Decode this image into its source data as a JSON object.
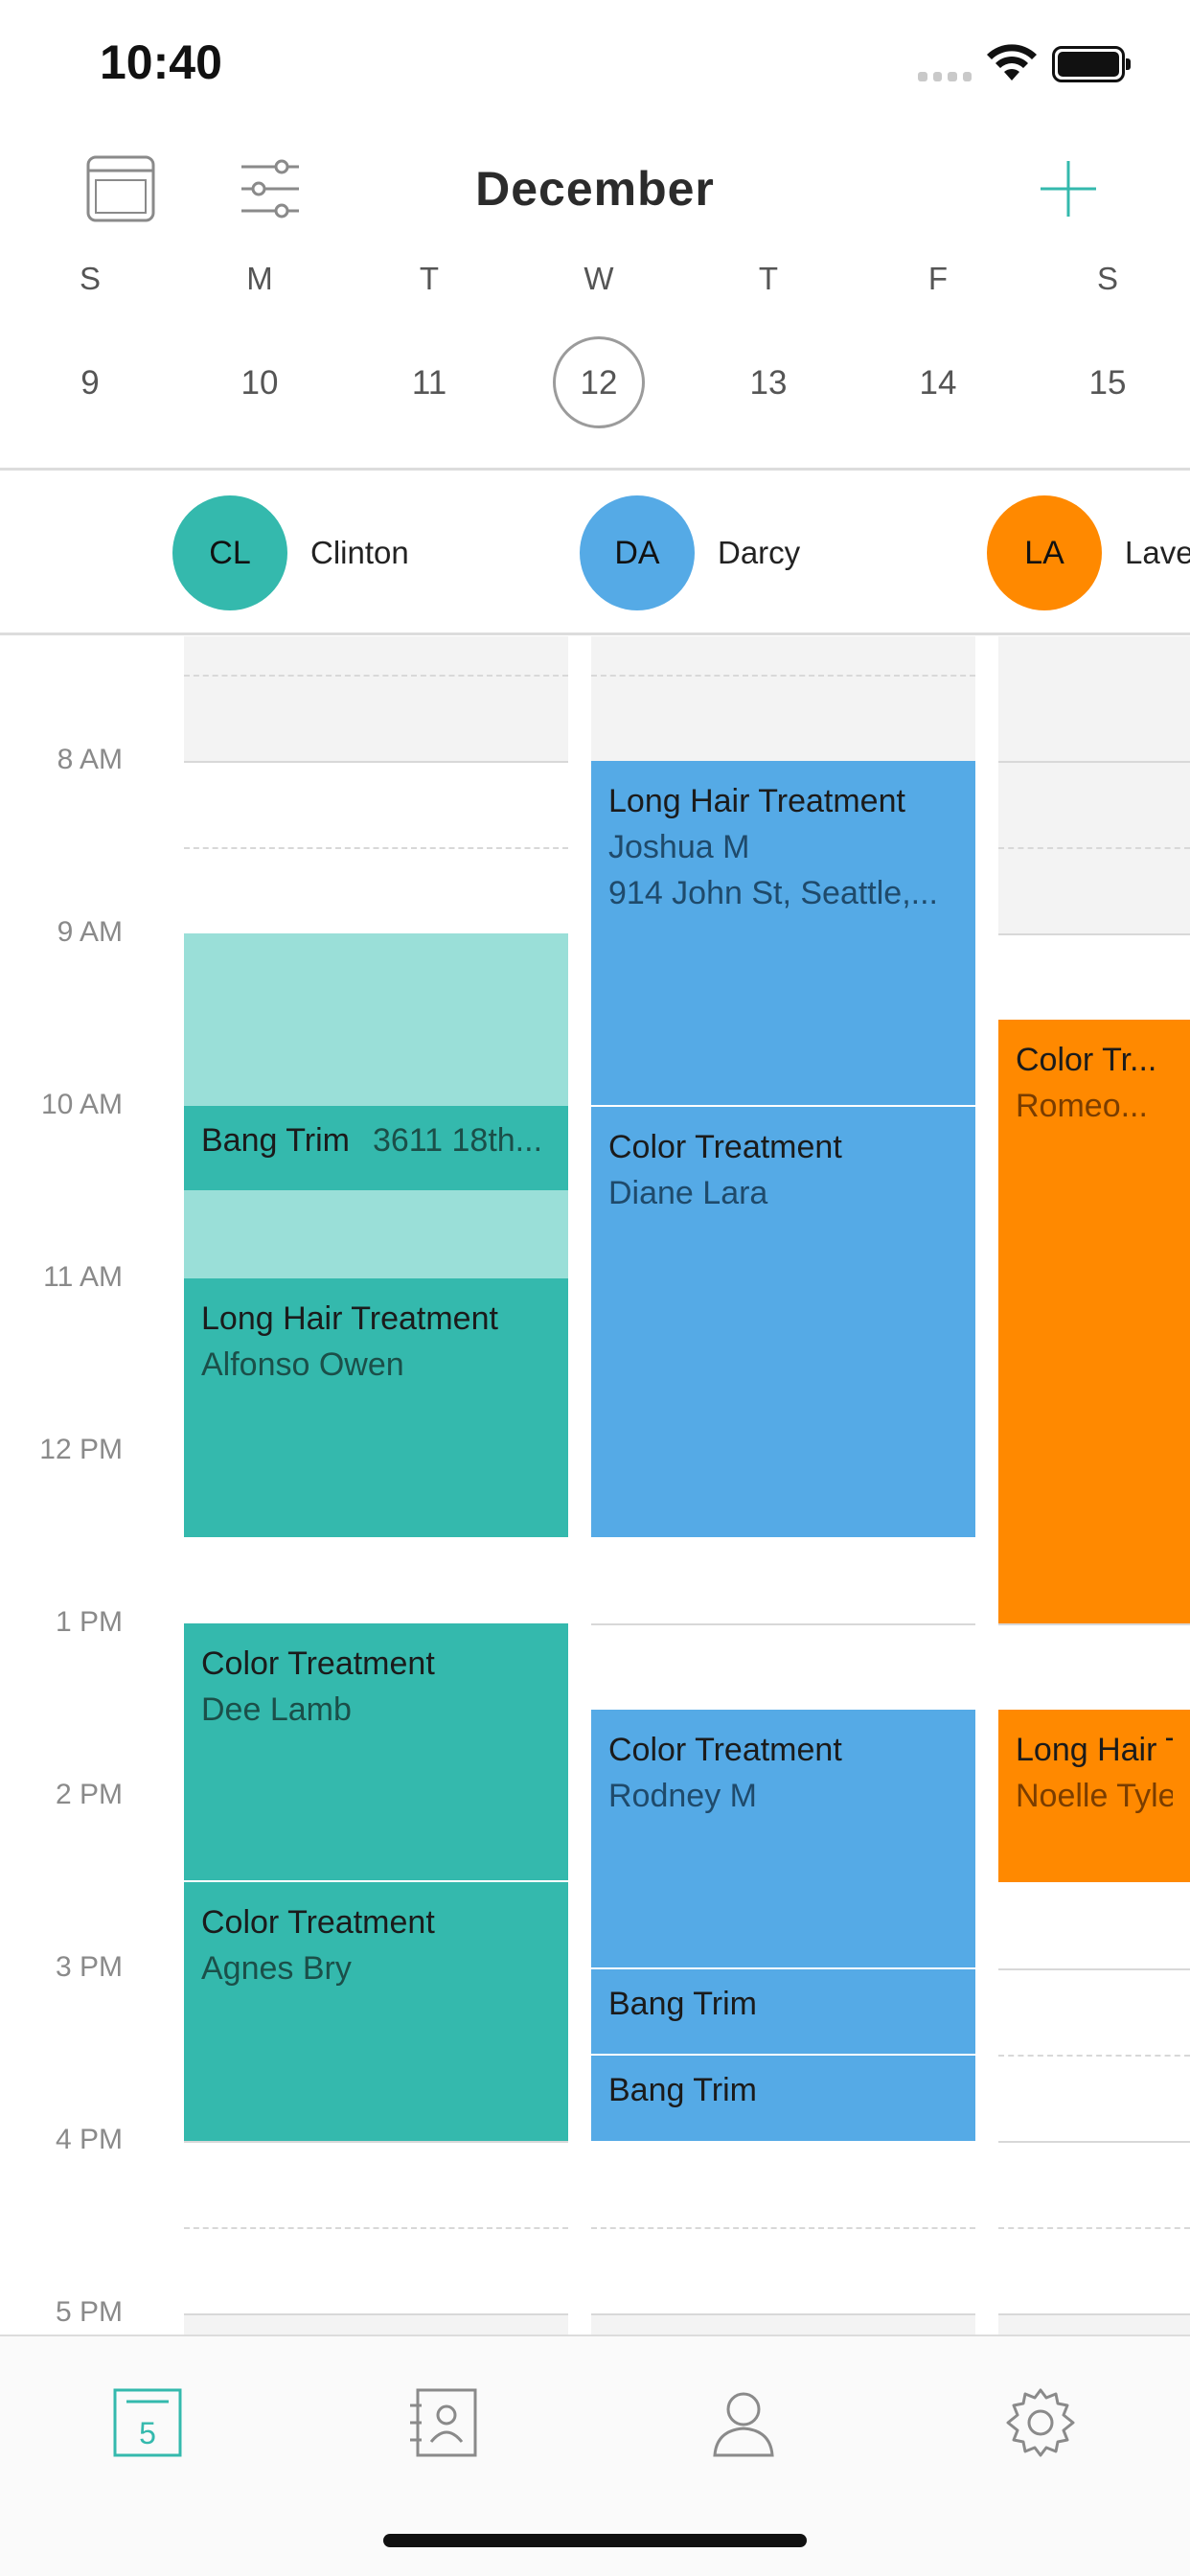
{
  "status": {
    "time": "10:40"
  },
  "header": {
    "month": "December",
    "layout_icon": "calendar-view-icon",
    "filter_icon": "sliders-icon",
    "add_icon": "plus-icon"
  },
  "week": {
    "days": [
      {
        "dow": "S",
        "date": "9"
      },
      {
        "dow": "M",
        "date": "10"
      },
      {
        "dow": "T",
        "date": "11"
      },
      {
        "dow": "W",
        "date": "12",
        "selected": true
      },
      {
        "dow": "T",
        "date": "13"
      },
      {
        "dow": "F",
        "date": "14"
      },
      {
        "dow": "S",
        "date": "15"
      }
    ]
  },
  "staff": [
    {
      "initials": "CL",
      "name": "Clinton",
      "color": "#34b9ad"
    },
    {
      "initials": "DA",
      "name": "Darcy",
      "color": "#55aae6"
    },
    {
      "initials": "LA",
      "name": "Laver",
      "color": "#ff8900"
    }
  ],
  "hours": [
    "8 AM",
    "9 AM",
    "10 AM",
    "11 AM",
    "12 PM",
    "1 PM",
    "2 PM",
    "3 PM",
    "4 PM",
    "5 PM"
  ],
  "clinton": {
    "bang_trim": {
      "title": "Bang Trim",
      "sub": "3611 18th..."
    },
    "long_hair": {
      "title": "Long Hair Treatment",
      "sub": "Alfonso Owen"
    },
    "color_1": {
      "title": "Color Treatment",
      "sub": "Dee Lamb"
    },
    "color_2": {
      "title": "Color Treatment",
      "sub": "Agnes Bry"
    }
  },
  "darcy": {
    "long_hair": {
      "title": "Long Hair Treatment",
      "sub": "Joshua M",
      "sub2": "914 John St, Seattle,..."
    },
    "color_1": {
      "title": "Color Treatment",
      "sub": "Diane Lara"
    },
    "color_2": {
      "title": "Color Treatment",
      "sub": "Rodney M"
    },
    "bang_1": {
      "title": "Bang Trim"
    },
    "bang_2": {
      "title": "Bang Trim"
    }
  },
  "laver": {
    "color": {
      "title": "Color Tr...",
      "sub": "Romeo..."
    },
    "long_hair": {
      "title": "Long Hair T",
      "sub": "Noelle Tyler"
    }
  },
  "tabbar": {
    "calendar_badge": "5",
    "tabs": [
      "calendar-icon",
      "contacts-book-icon",
      "person-icon",
      "gear-icon"
    ],
    "accent": "#34b9ad"
  }
}
